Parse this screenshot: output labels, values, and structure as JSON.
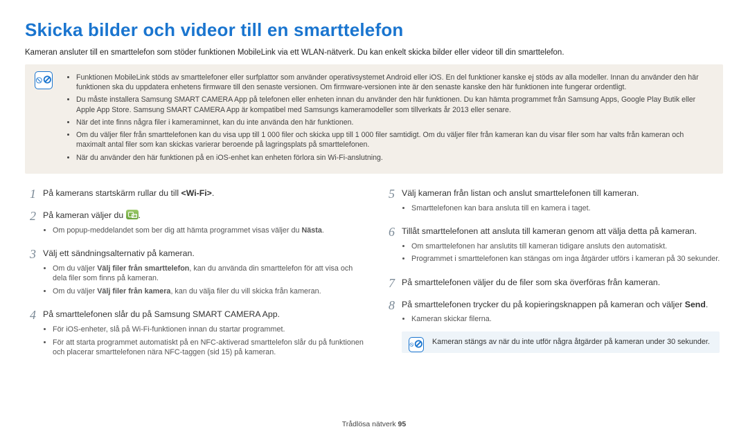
{
  "title": "Skicka bilder och videor till en smarttelefon",
  "intro": "Kameran ansluter till en smarttelefon som stöder funktionen MobileLink via ett WLAN-nätverk. Du kan enkelt skicka bilder eller videor till din smarttelefon.",
  "top_notes": [
    "Funktionen MobileLink stöds av smarttelefoner eller surfplattor som använder operativsystemet Android eller iOS. En del funktioner kanske ej stöds av alla modeller. Innan du använder den här funktionen ska du uppdatera enhetens firmware till den senaste versionen. Om firmware-versionen inte är den senaste kanske den här funktionen inte fungerar ordentligt.",
    "Du måste installera Samsung SMART CAMERA App på telefonen eller enheten innan du använder den här funktionen. Du kan hämta programmet från Samsung Apps, Google Play Butik eller Apple App Store. Samsung SMART CAMERA App är kompatibel med Samsungs kameramodeller som tillverkats år 2013 eller senare.",
    "När det inte finns några filer i kameraminnet, kan du inte använda den här funktionen.",
    "Om du väljer filer från smarttelefonen kan du visa upp till 1 000 filer och skicka upp till 1 000 filer samtidigt. Om du väljer filer från kameran kan du visar filer som har valts från kameran och maximalt antal filer som kan skickas varierar beroende på lagringsplats på smarttelefonen.",
    "När du använder den här funktionen på en iOS-enhet kan enheten förlora sin Wi-Fi-anslutning."
  ],
  "left": {
    "s1_a": "På kamerans startskärm rullar du till ",
    "s1_b": "<Wi-Fi>",
    "s1_c": ".",
    "s2_a": "På kameran väljer du ",
    "s2_c": ".",
    "s2_bullet_a": "Om popup-meddelandet som ber dig att hämta programmet visas väljer du ",
    "s2_bullet_b": "Nästa",
    "s2_bullet_c": ".",
    "s3": "Välj ett sändningsalternativ på kameran.",
    "s3_b1_a": "Om du väljer ",
    "s3_b1_b": "Välj filer från smarttelefon",
    "s3_b1_c": ", kan du använda din smarttelefon för att visa och dela filer som finns på kameran.",
    "s3_b2_a": "Om du väljer ",
    "s3_b2_b": "Välj filer från kamera",
    "s3_b2_c": ", kan du välja filer du vill skicka från kameran.",
    "s4": "På smarttelefonen slår du på Samsung SMART CAMERA App.",
    "s4_b1": "För iOS-enheter, slå på Wi-Fi-funktionen innan du startar programmet.",
    "s4_b2": "För att starta programmet automatiskt på en NFC-aktiverad smarttelefon slår du på funktionen och placerar smarttelefonen nära NFC-taggen (sid 15) på kameran."
  },
  "right": {
    "s5": "Välj kameran från listan och anslut smarttelefonen till kameran.",
    "s5_b1": "Smarttelefonen kan bara ansluta till en kamera i taget.",
    "s6": "Tillåt smarttelefonen att ansluta till kameran genom att välja detta på kameran.",
    "s6_b1": "Om smarttelefonen har anslutits till kameran tidigare ansluts den automatiskt.",
    "s6_b2": "Programmet i smarttelefonen kan stängas om inga åtgärder utförs i kameran på 30 sekunder.",
    "s7": "På smarttelefonen väljer du de filer som ska överföras från kameran.",
    "s8_a": "På smarttelefonen trycker du på kopieringsknappen på kameran och väljer ",
    "s8_b": "Send",
    "s8_c": ".",
    "s8_bullet": "Kameran skickar filerna.",
    "note2": "Kameran stängs av när du inte utför några åtgärder på kameran under 30 sekunder."
  },
  "footer_a": "Trådlösa nätverk  ",
  "footer_b": "95"
}
